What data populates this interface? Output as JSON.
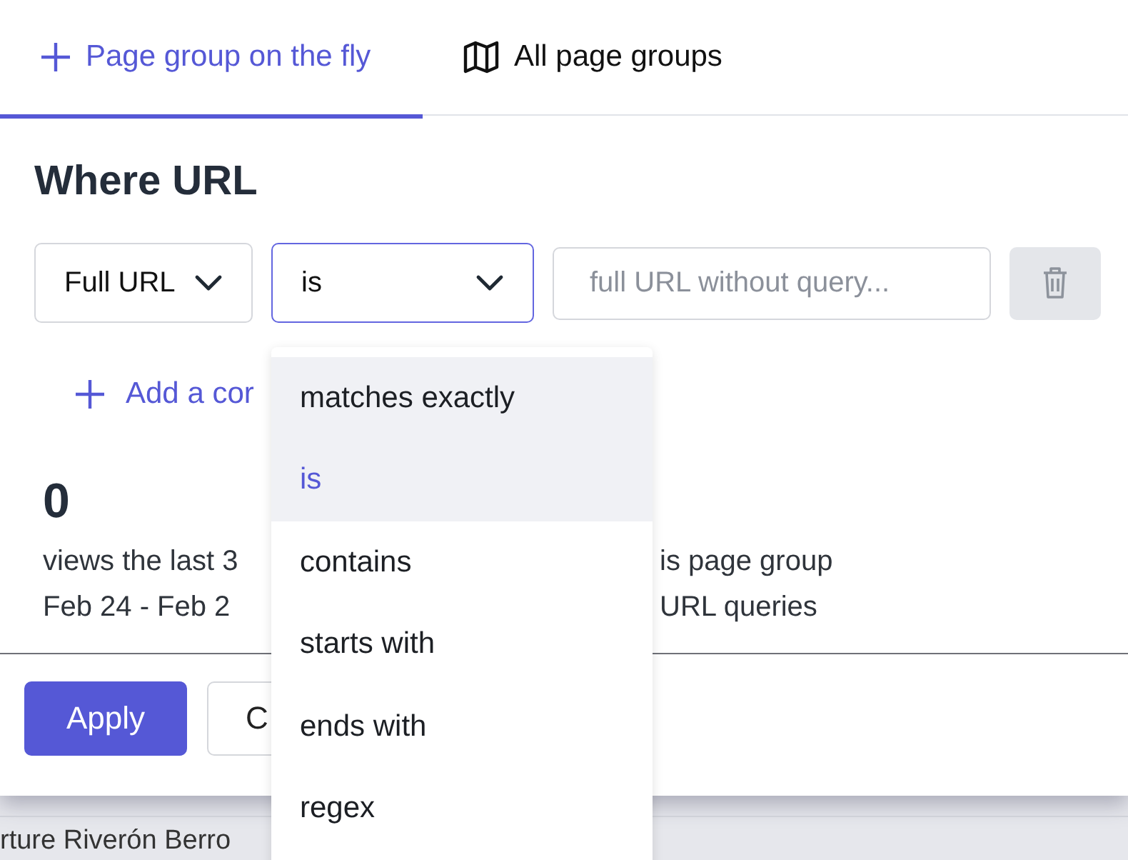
{
  "tabs": [
    {
      "label": "Page group on the fly",
      "selected": true
    },
    {
      "label": "All page groups",
      "selected": false
    }
  ],
  "heading": "Where URL",
  "filters": {
    "field_select": {
      "value": "Full URL"
    },
    "operator_select": {
      "value": "is",
      "open": true
    },
    "url_input": {
      "placeholder": "full URL without query..."
    }
  },
  "add_condition": "Add a cor",
  "stats": {
    "count": "0",
    "line_1": [
      "views the last 3",
      "is page group"
    ],
    "line_2": [
      "Feb 24 - Feb 2",
      "URL queries"
    ]
  },
  "buttons": [
    "Apply",
    "C"
  ],
  "operator_menu": [
    {
      "label": "matches exactly",
      "selected": false,
      "highlighted": true
    },
    {
      "label": "is",
      "selected": true,
      "highlighted": false
    },
    {
      "label": "contains",
      "selected": false,
      "highlighted": false
    },
    {
      "label": "starts with",
      "selected": false,
      "highlighted": false
    },
    {
      "label": "ends with",
      "selected": false,
      "highlighted": false
    },
    {
      "label": "regex",
      "selected": false,
      "highlighted": false
    }
  ],
  "background_text": "rture Riverón Berro"
}
